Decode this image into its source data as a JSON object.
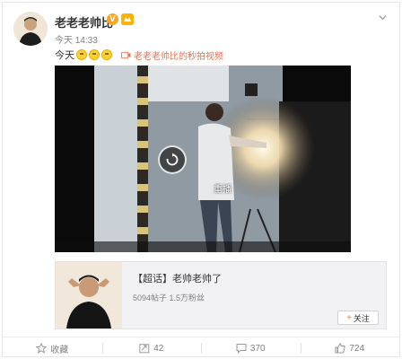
{
  "post": {
    "author": "老老老帅比",
    "verified_badge": "V",
    "time": "今天 14:33",
    "text": "今天",
    "emojis": [
      "smile-emoji",
      "smile-emoji",
      "smile-emoji"
    ],
    "video_link_label": "老老老帅比的秒拍视频"
  },
  "video": {
    "replay_label": "重播"
  },
  "topic": {
    "title": "【超话】老帅老帅了",
    "stats": "5094帖子 1.5万粉丝",
    "follow_label": "关注"
  },
  "actions": {
    "favorite_label": "收藏",
    "repost_count": "42",
    "comment_count": "370",
    "like_count": "724"
  },
  "colors": {
    "accent": "#eb7350",
    "follow_plus": "#ff8200",
    "badge": "#f6a623"
  }
}
